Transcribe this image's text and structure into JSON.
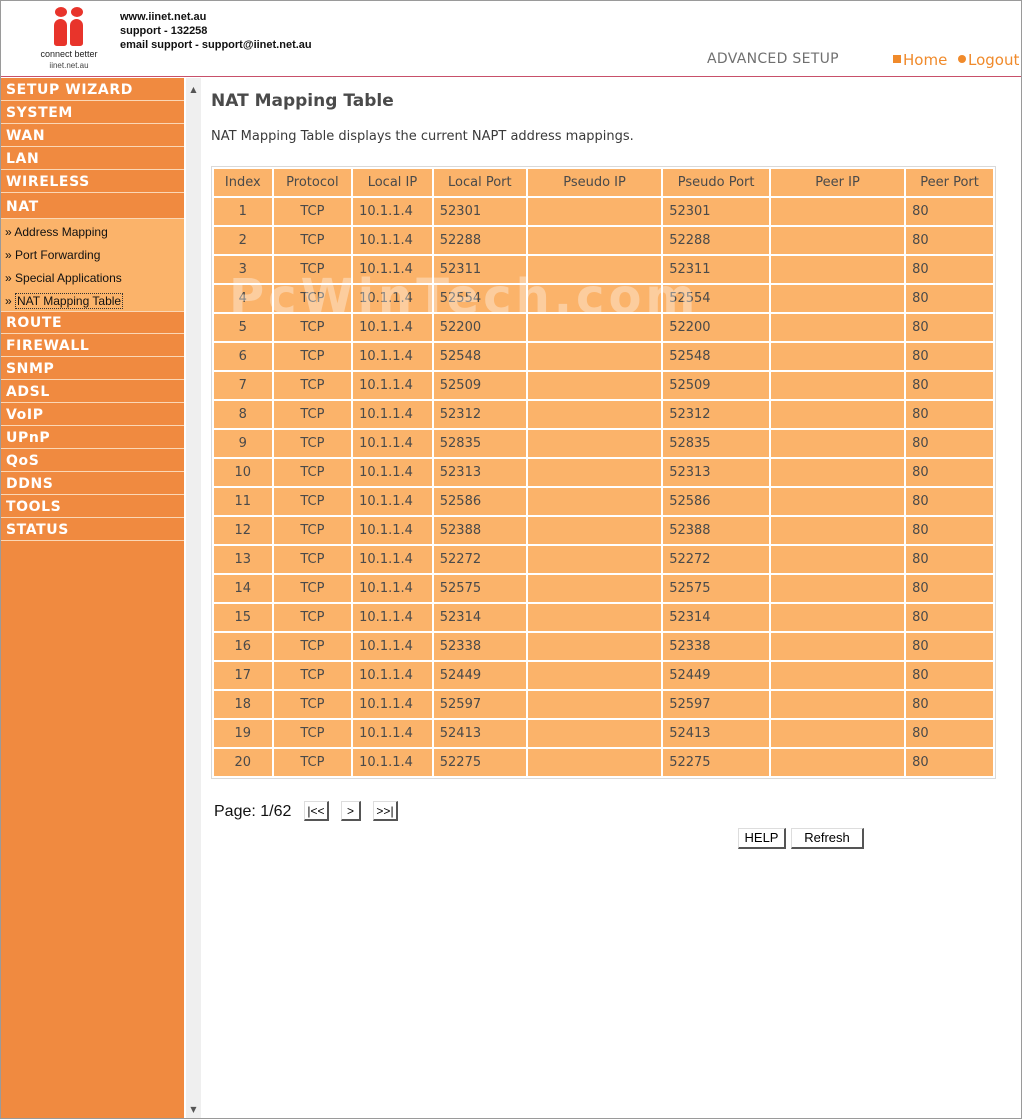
{
  "header": {
    "logo_text": "connect better",
    "logo_url": "iinet.net.au",
    "contact_lines": [
      "www.iinet.net.au",
      "support - 132258",
      "email support - support@iinet.net.au"
    ],
    "section_title": "ADVANCED SETUP",
    "home_label": "Home",
    "logout_label": "Logout",
    "accent_color": "#f08a2b"
  },
  "sidebar": {
    "items": [
      {
        "label": "SETUP WIZARD"
      },
      {
        "label": "SYSTEM"
      },
      {
        "label": "WAN"
      },
      {
        "label": "LAN"
      },
      {
        "label": "WIRELESS"
      },
      {
        "label": "NAT"
      },
      {
        "label": "ROUTE"
      },
      {
        "label": "FIREWALL"
      },
      {
        "label": "SNMP"
      },
      {
        "label": "ADSL"
      },
      {
        "label": "VoIP"
      },
      {
        "label": "UPnP"
      },
      {
        "label": "QoS"
      },
      {
        "label": "DDNS"
      },
      {
        "label": "TOOLS"
      },
      {
        "label": "STATUS"
      }
    ],
    "nat_submenu": [
      {
        "label": "Address Mapping"
      },
      {
        "label": "Port Forwarding"
      },
      {
        "label": "Special Applications"
      },
      {
        "label": "NAT Mapping Table",
        "active": true
      }
    ],
    "background_color": "#f08a40"
  },
  "main": {
    "title": "NAT Mapping Table",
    "description": "NAT Mapping Table displays the current NAPT address mappings.",
    "table": {
      "headers": [
        "Index",
        "Protocol",
        "Local IP",
        "Local Port",
        "Pseudo IP",
        "Pseudo Port",
        "Peer IP",
        "Peer Port"
      ],
      "rows": [
        [
          "1",
          "TCP",
          "10.1.1.4",
          "52301",
          "",
          "52301",
          "",
          "80"
        ],
        [
          "2",
          "TCP",
          "10.1.1.4",
          "52288",
          "",
          "52288",
          "",
          "80"
        ],
        [
          "3",
          "TCP",
          "10.1.1.4",
          "52311",
          "",
          "52311",
          "",
          "80"
        ],
        [
          "4",
          "TCP",
          "10.1.1.4",
          "52554",
          "",
          "52554",
          "",
          "80"
        ],
        [
          "5",
          "TCP",
          "10.1.1.4",
          "52200",
          "",
          "52200",
          "",
          "80"
        ],
        [
          "6",
          "TCP",
          "10.1.1.4",
          "52548",
          "",
          "52548",
          "",
          "80"
        ],
        [
          "7",
          "TCP",
          "10.1.1.4",
          "52509",
          "",
          "52509",
          "",
          "80"
        ],
        [
          "8",
          "TCP",
          "10.1.1.4",
          "52312",
          "",
          "52312",
          "",
          "80"
        ],
        [
          "9",
          "TCP",
          "10.1.1.4",
          "52835",
          "",
          "52835",
          "",
          "80"
        ],
        [
          "10",
          "TCP",
          "10.1.1.4",
          "52313",
          "",
          "52313",
          "",
          "80"
        ],
        [
          "11",
          "TCP",
          "10.1.1.4",
          "52586",
          "",
          "52586",
          "",
          "80"
        ],
        [
          "12",
          "TCP",
          "10.1.1.4",
          "52388",
          "",
          "52388",
          "",
          "80"
        ],
        [
          "13",
          "TCP",
          "10.1.1.4",
          "52272",
          "",
          "52272",
          "",
          "80"
        ],
        [
          "14",
          "TCP",
          "10.1.1.4",
          "52575",
          "",
          "52575",
          "",
          "80"
        ],
        [
          "15",
          "TCP",
          "10.1.1.4",
          "52314",
          "",
          "52314",
          "",
          "80"
        ],
        [
          "16",
          "TCP",
          "10.1.1.4",
          "52338",
          "",
          "52338",
          "",
          "80"
        ],
        [
          "17",
          "TCP",
          "10.1.1.4",
          "52449",
          "",
          "52449",
          "",
          "80"
        ],
        [
          "18",
          "TCP",
          "10.1.1.4",
          "52597",
          "",
          "52597",
          "",
          "80"
        ],
        [
          "19",
          "TCP",
          "10.1.1.4",
          "52413",
          "",
          "52413",
          "",
          "80"
        ],
        [
          "20",
          "TCP",
          "10.1.1.4",
          "52275",
          "",
          "52275",
          "",
          "80"
        ]
      ],
      "cell_color": "#fbb36a"
    },
    "pager": {
      "text": "Page: 1/62",
      "first_label": "|<<",
      "next_label": ">",
      "last_label": ">>|"
    },
    "help_label": "HELP",
    "refresh_label": "Refresh"
  }
}
